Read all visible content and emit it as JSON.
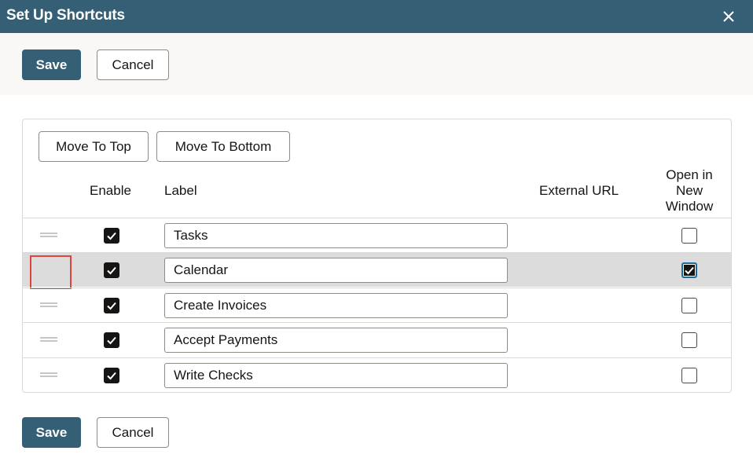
{
  "dialog": {
    "title": "Set Up Shortcuts",
    "close_icon": "close-icon"
  },
  "toolbar": {
    "save_label": "Save",
    "cancel_label": "Cancel"
  },
  "panel": {
    "move_to_top_label": "Move To Top",
    "move_to_bottom_label": "Move To Bottom"
  },
  "table": {
    "headers": {
      "enable": "Enable",
      "label": "Label",
      "external_url": "External URL",
      "open_in_new_window": "Open in New Window",
      "open_line1": "Open in",
      "open_line2": "New",
      "open_line3": "Window"
    },
    "rows": [
      {
        "enabled": true,
        "label": "Tasks",
        "external_url": "",
        "open_in_new_window": false,
        "selected": false
      },
      {
        "enabled": true,
        "label": "Calendar",
        "external_url": "",
        "open_in_new_window": true,
        "selected": true
      },
      {
        "enabled": true,
        "label": "Create Invoices",
        "external_url": "",
        "open_in_new_window": false,
        "selected": false
      },
      {
        "enabled": true,
        "label": "Accept Payments",
        "external_url": "",
        "open_in_new_window": false,
        "selected": false
      },
      {
        "enabled": true,
        "label": "Write Checks",
        "external_url": "",
        "open_in_new_window": false,
        "selected": false
      }
    ]
  },
  "footer": {
    "save_label": "Save",
    "cancel_label": "Cancel"
  },
  "colors": {
    "header_bg": "#355f75",
    "primary_button": "#355f75",
    "selected_row": "#dcdcdc",
    "highlight_box": "#e0433b",
    "toolbar_bg": "#f9f8f6"
  }
}
